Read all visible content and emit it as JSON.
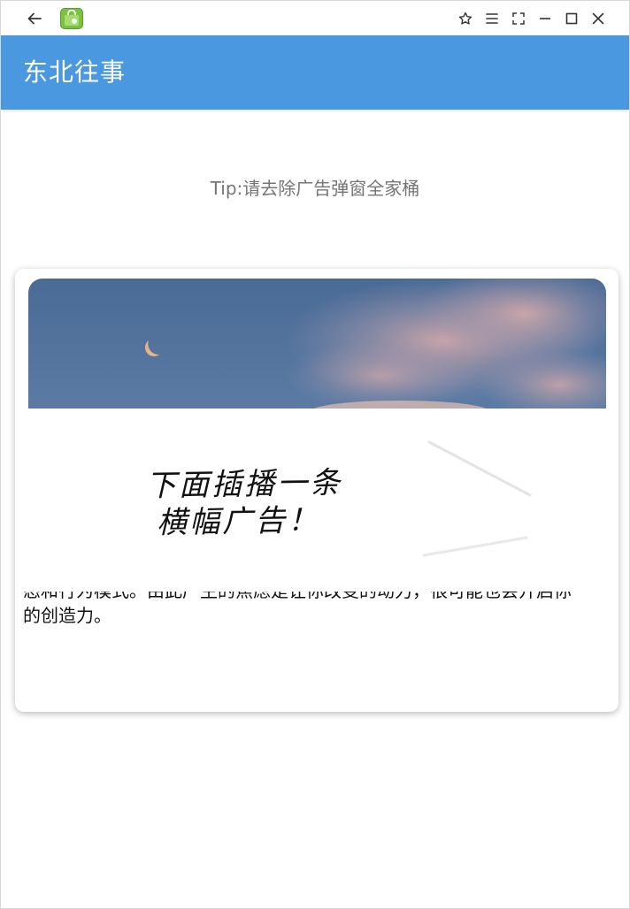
{
  "window": {
    "back_icon": "arrow-left-icon",
    "app_icon": "bag-icon",
    "controls": [
      "pin-icon",
      "menu-icon",
      "fullscreen-icon",
      "minimize-icon",
      "maximize-icon",
      "close-icon"
    ]
  },
  "appbar": {
    "title": "东北往事",
    "color": "#4a98e0"
  },
  "tip": "Tip:请去除广告弹窗全家桶",
  "card": {
    "image": "night-sky-moon-clouds",
    "banner": {
      "line1": "下面插播一条",
      "line2": "横幅广告！"
    },
    "article": {
      "partial_line": "态和行为模式。由此产生的焦虑是让你改变的动力，很可能也会开启你",
      "last_line": "的创造力。"
    }
  }
}
